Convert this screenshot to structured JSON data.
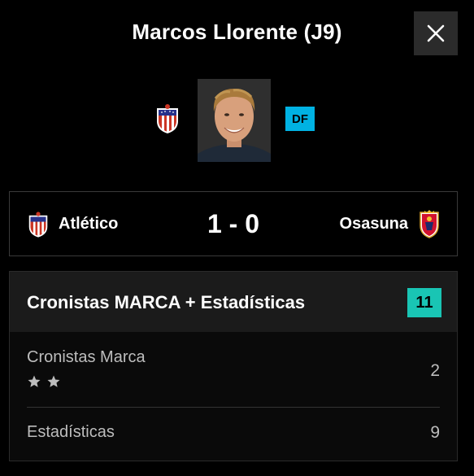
{
  "modal": {
    "title": "Marcos Llorente (J9)",
    "close_icon": "close-icon"
  },
  "player": {
    "position": "DF",
    "position_color": "#00b2e3",
    "team_crest": "atletico-crest-icon"
  },
  "match": {
    "home_team": "Atlético",
    "score": "1 - 0",
    "away_team": "Osasuna",
    "home_crest": "atletico-crest-icon",
    "away_crest": "osasuna-crest-icon"
  },
  "ratings": {
    "title": "Cronistas MARCA + Estadísticas",
    "total": "11",
    "total_color": "#19c5b4",
    "rows": [
      {
        "label": "Cronistas Marca",
        "value": "2",
        "stars": 2
      },
      {
        "label": "Estadísticas",
        "value": "9"
      }
    ]
  }
}
